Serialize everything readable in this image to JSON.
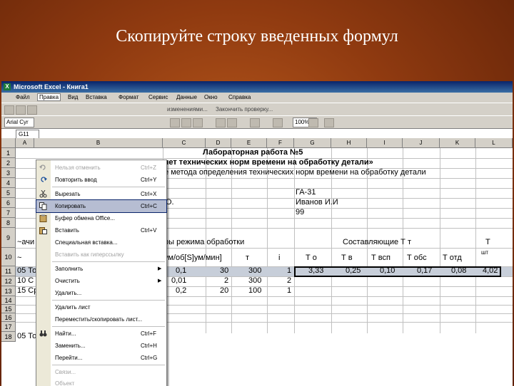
{
  "slide": {
    "title": "Скопируйте строку введенных формул"
  },
  "window": {
    "title": "Microsoft Excel - Книга1",
    "app_icon": "excel-icon"
  },
  "menubar": {
    "items": [
      "Файл",
      "Правка",
      "Вид",
      "Вставка",
      "Формат",
      "Сервис",
      "Данные",
      "Окно",
      "Справка"
    ],
    "active": "Правка"
  },
  "toolbar1": {
    "labels": [
      "изменениями...",
      "Закончить проверку..."
    ]
  },
  "toolbar2": {
    "font": "Arial Cyr",
    "zoom": "100%"
  },
  "formula_bar": {
    "name_box": "G11"
  },
  "columns": [
    "A",
    "B",
    "C",
    "D",
    "E",
    "F",
    "G",
    "H",
    "I",
    "J",
    "K",
    "L"
  ],
  "rows": [
    "1",
    "2",
    "3",
    "4",
    "5",
    "6",
    "7",
    "8",
    "9",
    "10",
    "11",
    "12",
    "13",
    "14",
    "15",
    "16",
    "17",
    "18"
  ],
  "cells": {
    "title": "Лабораторная работа №5",
    "subtitle": "чет технических норм времени на обработку детали»",
    "line3": "е метода определения технических норм времени на обработку детали",
    "group": "ГА-31",
    "name_partial": "О.",
    "student": "Иванов И.И",
    "num": "99",
    "r9_left": "~ачи",
    "r9_mid": "ры режима обработки",
    "r9_right": "Составляющие Т т",
    "r9_far": "Т",
    "r10_left": "~",
    "r10_units": "ум/об[S]ум/мин]",
    "r10_col_t": "т",
    "r10_col_i": "i",
    "r10_to": "Т о",
    "r10_tv": "Т в",
    "r10_tvsp": "Т всп",
    "r10_tobs": "Т обс",
    "r10_totd": "Т отд",
    "r10_sht": "шт",
    "r11": [
      "05 То",
      "0,1",
      "30",
      "300",
      "1",
      "3,33",
      "0,25",
      "0,10",
      "0,17",
      "0,08",
      "4,02"
    ],
    "r12": [
      "10 С",
      "0,01",
      "2",
      "300",
      "2"
    ],
    "r13": [
      "15 Ср",
      "0,2",
      "20",
      "100",
      "1"
    ],
    "r17": "05 То"
  },
  "menu": {
    "items": [
      {
        "label": "Нельзя отменить",
        "shortcut": "Ctrl+Z",
        "icon": "undo-icon",
        "disabled": true
      },
      {
        "label": "Повторить ввод",
        "shortcut": "Ctrl+Y",
        "icon": "redo-icon",
        "disabled": false
      },
      {
        "label": "Вырезать",
        "shortcut": "Ctrl+X",
        "icon": "scissors-icon",
        "disabled": false
      },
      {
        "label": "Копировать",
        "shortcut": "Ctrl+C",
        "icon": "copy-icon",
        "disabled": false,
        "highlighted": true
      },
      {
        "label": "Буфер обмена Office...",
        "shortcut": "",
        "icon": "clipboard-icon",
        "disabled": false
      },
      {
        "label": "Вставить",
        "shortcut": "Ctrl+V",
        "icon": "paste-icon",
        "disabled": false
      },
      {
        "label": "Специальная вставка...",
        "shortcut": "",
        "icon": "",
        "disabled": false
      },
      {
        "label": "Вставить как гиперссылку",
        "shortcut": "",
        "icon": "",
        "disabled": true
      },
      {
        "label": "Заполнить",
        "shortcut": "",
        "icon": "",
        "disabled": false,
        "submenu": true
      },
      {
        "label": "Очистить",
        "shortcut": "",
        "icon": "",
        "disabled": false,
        "submenu": true
      },
      {
        "label": "Удалить...",
        "shortcut": "",
        "icon": "",
        "disabled": false
      },
      {
        "label": "Удалить лист",
        "shortcut": "",
        "icon": "",
        "disabled": false
      },
      {
        "label": "Переместить/скопировать лист...",
        "shortcut": "",
        "icon": "",
        "disabled": false
      },
      {
        "label": "Найти...",
        "shortcut": "Ctrl+F",
        "icon": "binoculars-icon",
        "disabled": false
      },
      {
        "label": "Заменить...",
        "shortcut": "Ctrl+H",
        "icon": "",
        "disabled": false
      },
      {
        "label": "Перейти...",
        "shortcut": "Ctrl+G",
        "icon": "",
        "disabled": false
      },
      {
        "label": "Связи...",
        "shortcut": "",
        "icon": "",
        "disabled": true
      },
      {
        "label": "Объект",
        "shortcut": "",
        "icon": "",
        "disabled": true
      }
    ]
  },
  "colors": {
    "selection": "#c7ced9",
    "menu_highlight": "#b6bdd2",
    "titlebar": "#0a246a"
  }
}
